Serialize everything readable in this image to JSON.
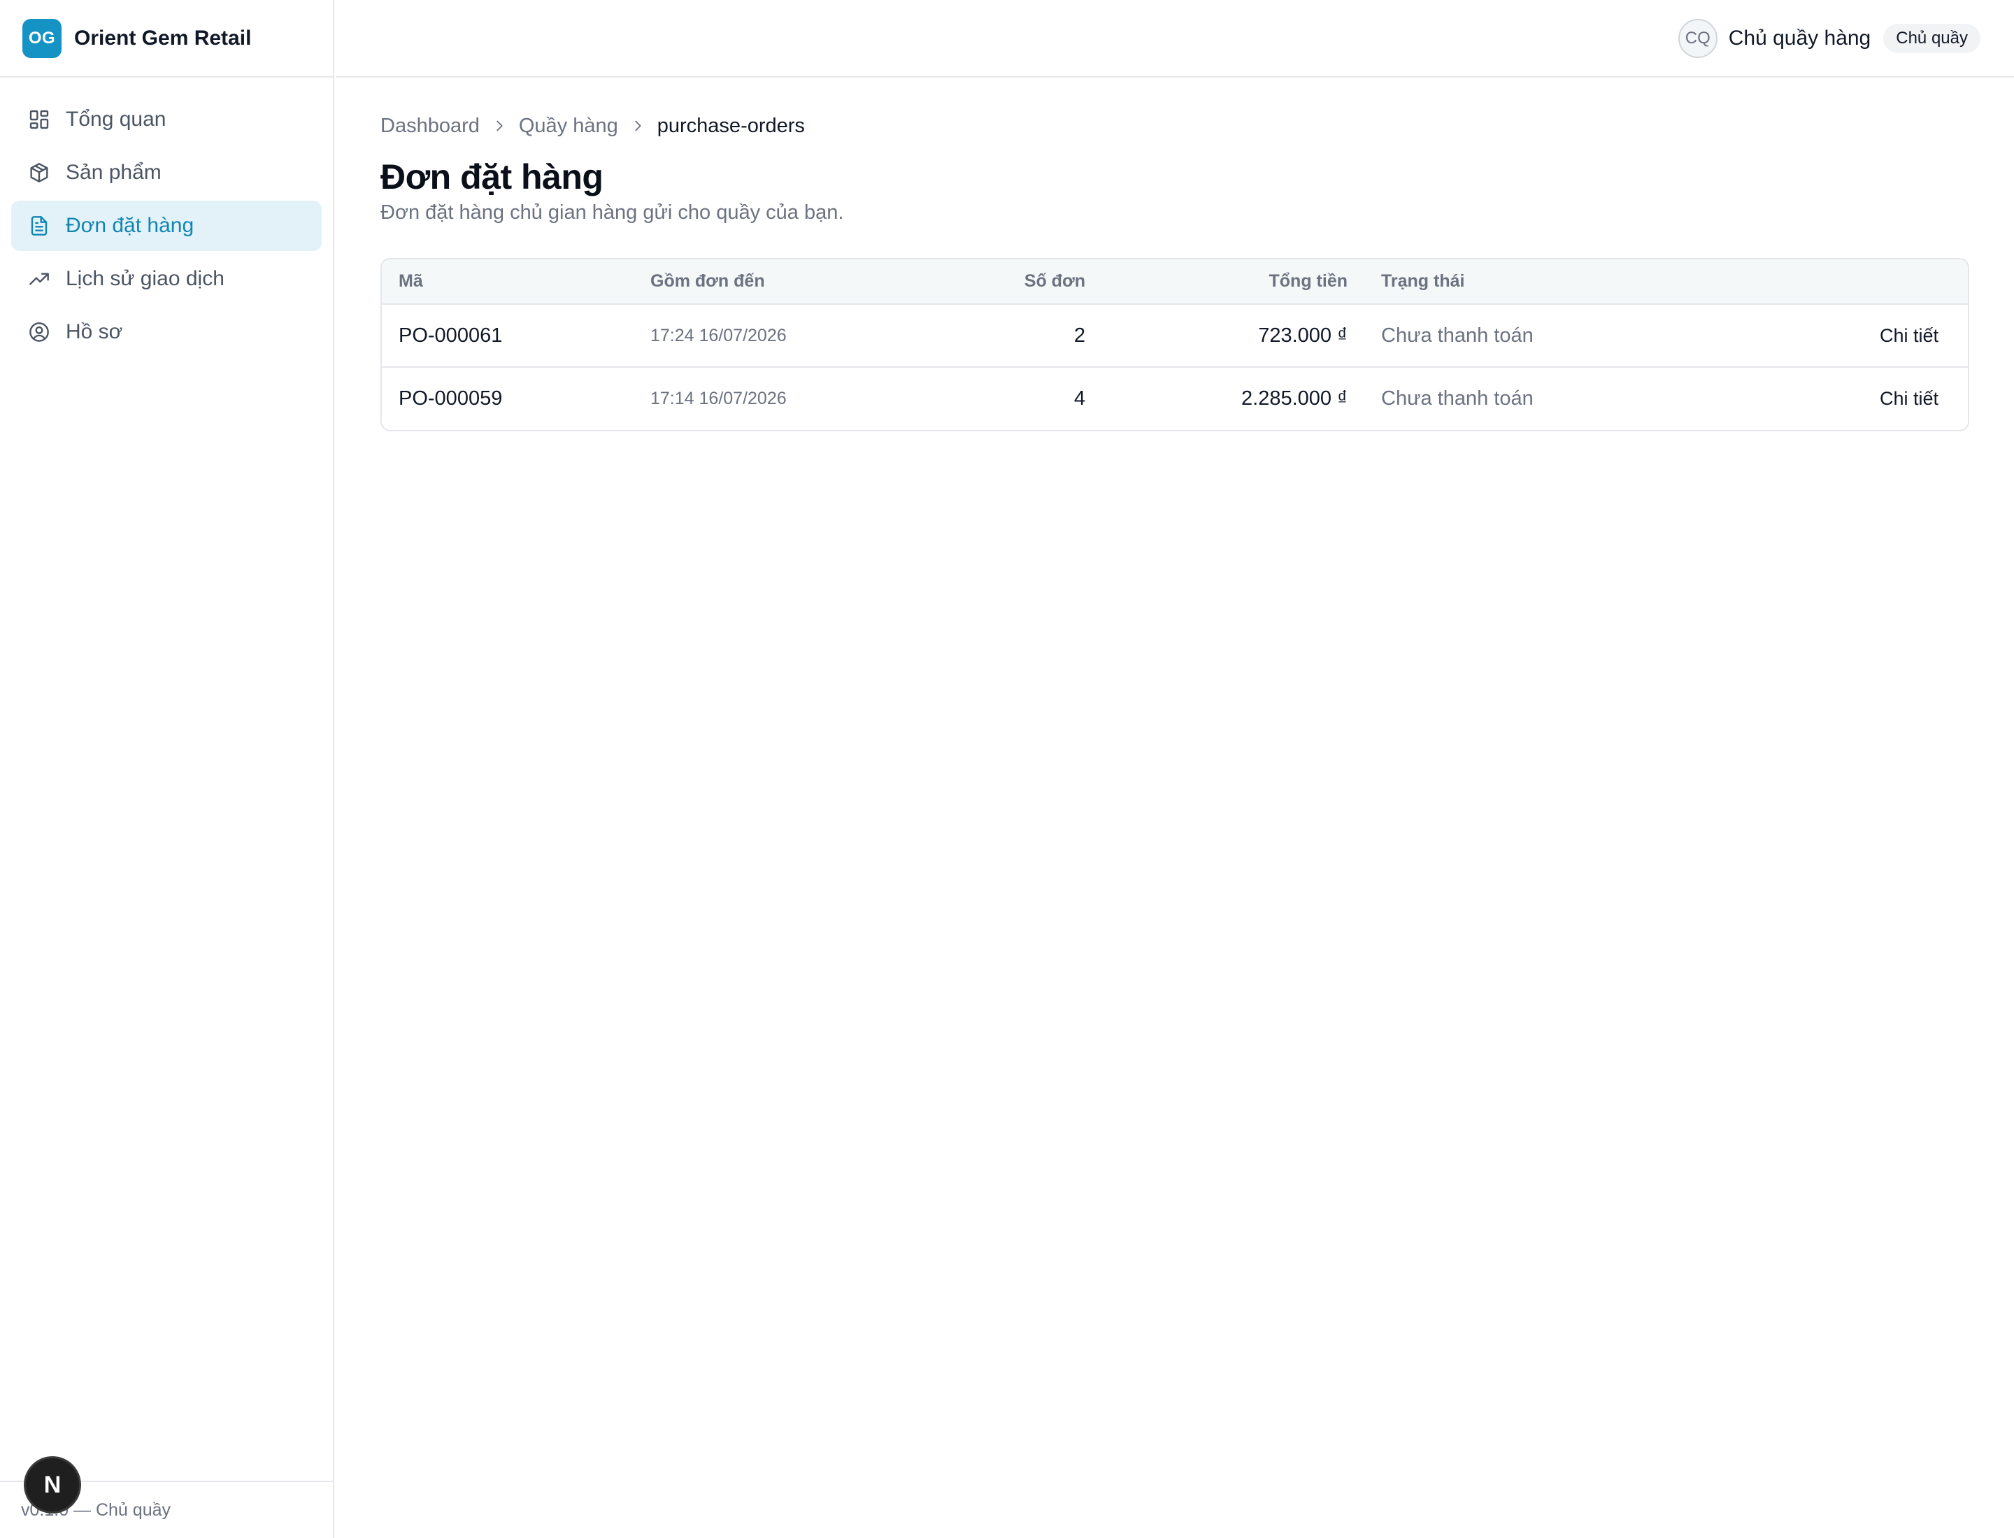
{
  "brand": {
    "logo_text": "OG",
    "name": "Orient Gem Retail",
    "accent_color": "#1593c4"
  },
  "sidebar": {
    "items": [
      {
        "label": "Tổng quan",
        "icon": "dashboard-grid-icon",
        "active": false
      },
      {
        "label": "Sản phẩm",
        "icon": "package-box-icon",
        "active": false
      },
      {
        "label": "Đơn đặt hàng",
        "icon": "document-icon",
        "active": true
      },
      {
        "label": "Lịch sử giao dịch",
        "icon": "trending-up-icon",
        "active": false
      },
      {
        "label": "Hồ sơ",
        "icon": "user-circle-icon",
        "active": false
      }
    ],
    "footer_text": "v0.1.0 — Chủ quầy",
    "floating_badge": "N"
  },
  "header": {
    "avatar_initials": "CQ",
    "user_name": "Chủ quầy hàng",
    "role_badge": "Chủ quầy"
  },
  "breadcrumb": [
    "Dashboard",
    "Quầy hàng",
    "purchase-orders"
  ],
  "page": {
    "title": "Đơn đặt hàng",
    "subtitle": "Đơn đặt hàng chủ gian hàng gửi cho quầy của bạn."
  },
  "table": {
    "columns": [
      "Mã",
      "Gồm đơn đến",
      "Số đơn",
      "Tổng tiền",
      "Trạng thái",
      ""
    ],
    "rows": [
      {
        "code": "PO-000061",
        "time": "17:24 16/07/2026",
        "count": "2",
        "total": "723.000 ₫",
        "status": "Chưa thanh toán",
        "action": "Chi tiết"
      },
      {
        "code": "PO-000059",
        "time": "17:14 16/07/2026",
        "count": "4",
        "total": "2.285.000 ₫",
        "status": "Chưa thanh toán",
        "action": "Chi tiết"
      }
    ]
  }
}
